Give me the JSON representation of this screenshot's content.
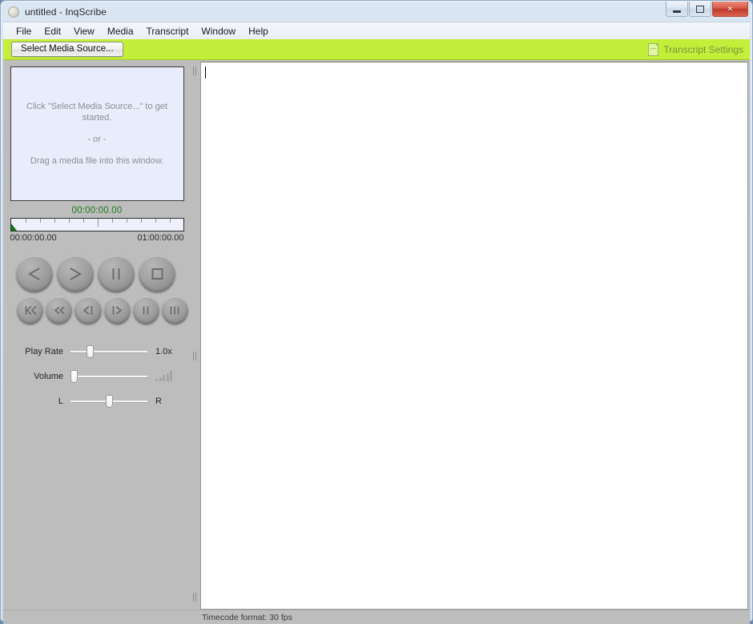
{
  "window": {
    "title": "untitled - InqScribe",
    "app_icon": "circle-app-icon",
    "minimize_label": "Minimize",
    "maximize_label": "Maximize",
    "close_label": "×"
  },
  "menubar": {
    "items": [
      {
        "label": "File"
      },
      {
        "label": "Edit"
      },
      {
        "label": "View"
      },
      {
        "label": "Media"
      },
      {
        "label": "Transcript"
      },
      {
        "label": "Window"
      },
      {
        "label": "Help"
      }
    ]
  },
  "toolbar": {
    "select_media_label": "Select Media Source...",
    "transcript_settings_label": "Transcript Settings",
    "transcript_settings_icon": "document-icon",
    "background_color": "#c3ee3a"
  },
  "media_panel": {
    "placeholder_line1": "Click \"Select Media Source...\" to get started.",
    "placeholder_line2": "- or -",
    "placeholder_line3": "Drag a media file into this window.",
    "current_timecode": "00:00:00.00",
    "timecode_color": "#1f7a1f",
    "timeline_start": "00:00:00.00",
    "timeline_end": "01:00:00.00",
    "playhead_position_percent": 0
  },
  "transport": {
    "row1": [
      {
        "name": "play-reverse-button",
        "icon": "triangle-left-icon"
      },
      {
        "name": "play-button",
        "icon": "triangle-right-icon"
      },
      {
        "name": "pause-button",
        "icon": "pause-icon"
      },
      {
        "name": "stop-button",
        "icon": "stop-square-icon"
      }
    ],
    "row2": [
      {
        "name": "skip-to-start-button",
        "icon": "skip-back-icon"
      },
      {
        "name": "rewind-button",
        "icon": "rewind-icon"
      },
      {
        "name": "step-back-button",
        "icon": "step-back-icon"
      },
      {
        "name": "step-forward-button",
        "icon": "step-forward-icon"
      },
      {
        "name": "frame-back-button",
        "icon": "frame-back-icon"
      },
      {
        "name": "frame-forward-button",
        "icon": "frame-forward-icon"
      }
    ]
  },
  "sliders": {
    "play_rate": {
      "label": "Play Rate",
      "value_label": "1.0x",
      "thumb_percent": 22
    },
    "volume": {
      "label": "Volume",
      "thumb_percent": 2,
      "meter_icon": "volume-bars-icon"
    },
    "balance": {
      "left_label": "L",
      "right_label": "R",
      "thumb_percent": 48
    }
  },
  "transcript": {
    "content": "",
    "placeholder": ""
  },
  "statusbar": {
    "text": "Timecode format: 30 fps"
  }
}
